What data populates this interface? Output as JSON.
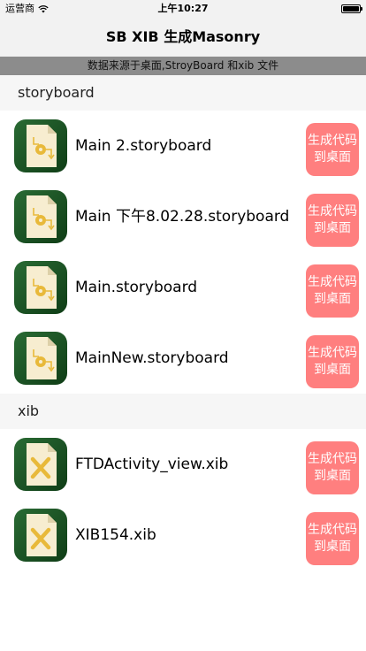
{
  "status_bar": {
    "carrier": "运营商",
    "time": "上午10:27",
    "battery_level": 1.0
  },
  "nav": {
    "title": "SB XIB 生成Masonry"
  },
  "banner": {
    "text": "数据来源于桌面,StroyBoard 和xib 文件"
  },
  "sections": [
    {
      "header": "storyboard",
      "items": [
        {
          "name": "Main 2.storyboard",
          "icon": "storyboard-file-icon",
          "button": "生成代码到桌面"
        },
        {
          "name": "Main 下午8.02.28.storyboard",
          "icon": "storyboard-file-icon",
          "button": "生成代码到桌面"
        },
        {
          "name": "Main.storyboard",
          "icon": "storyboard-file-icon",
          "button": "生成代码到桌面"
        },
        {
          "name": "MainNew.storyboard",
          "icon": "storyboard-file-icon",
          "button": "生成代码到桌面"
        }
      ]
    },
    {
      "header": "xib",
      "items": [
        {
          "name": "FTDActivity_view.xib",
          "icon": "xib-file-icon",
          "button": "生成代码到桌面"
        },
        {
          "name": "XIB154.xib",
          "icon": "xib-file-icon",
          "button": "生成代码到桌面"
        }
      ]
    }
  ],
  "colors": {
    "button": "#ff7f7f",
    "banner": "#8c8c8c",
    "icon_bg": "#1e5a26",
    "nav_bg": "#f2f2f2"
  }
}
